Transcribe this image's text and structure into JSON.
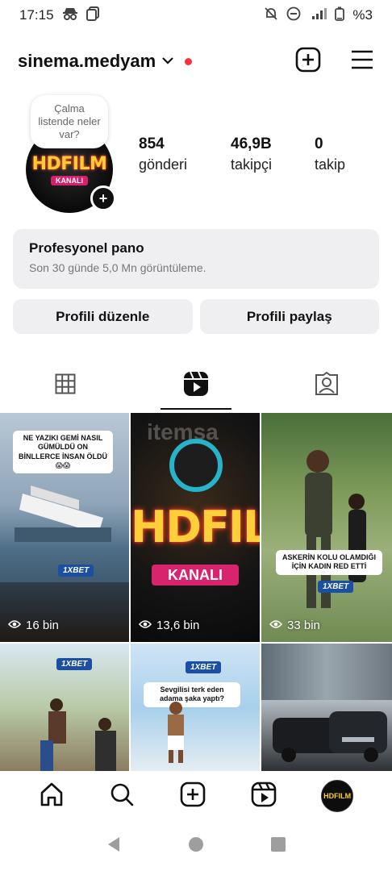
{
  "status_bar": {
    "time": "17:15",
    "battery": "%3"
  },
  "header": {
    "username": "sinema.medyam"
  },
  "profile": {
    "note": "Çalma listende neler var?",
    "avatar_title": "HDFILM",
    "avatar_sub": "KANALI",
    "stats": [
      {
        "value": "854",
        "label": "gönderi"
      },
      {
        "value": "46,9B",
        "label": "takipçi"
      },
      {
        "value": "0",
        "label": "takip"
      }
    ]
  },
  "dashboard": {
    "title": "Profesyonel pano",
    "subtitle": "Son 30 günde 5,0 Mn görüntüleme."
  },
  "buttons": {
    "edit": "Profili düzenle",
    "share": "Profili paylaş"
  },
  "posts": [
    {
      "caption": "NE YAZIKI GEMİ NASIL GÜMÜLDÜ ON BİNLLERCE İNSAN ÖLDÜ😱😱",
      "badge": "1XBET",
      "views": "16 bin"
    },
    {
      "logo": "HDFILM",
      "kanali": "KANALI",
      "watermark": "itemsa",
      "views": "13,6 bin"
    },
    {
      "caption": "ASKERİN KOLU OLAMDIĞI İÇİN KADIN RED ETTİ",
      "badge": "1XBET",
      "views": "33 bin"
    },
    {
      "badge": "1XBET"
    },
    {
      "caption": "Sevgilisi terk eden adama şaka yaptı?",
      "badge": "1XBET"
    },
    {}
  ],
  "colors": {
    "accent_red": "#ff3040",
    "button_bg": "#efeff1",
    "brand_pink": "#d71f6a",
    "brand_yellow": "#ffcc33",
    "bet_blue": "#1a4fa3"
  }
}
